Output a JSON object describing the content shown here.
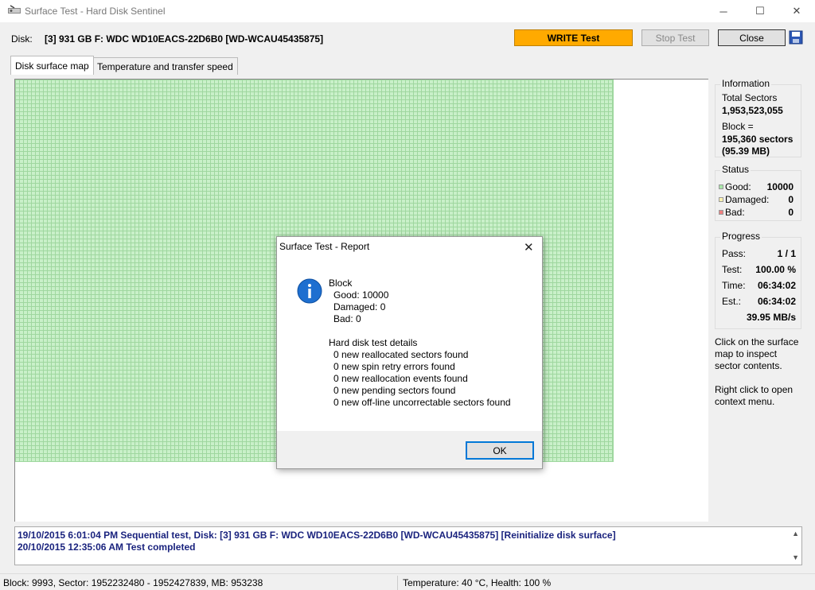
{
  "window": {
    "title": "Surface Test - Hard Disk Sentinel",
    "minimize": "─",
    "maximize": "☐",
    "close": "✕"
  },
  "toolbar": {
    "disk_label": "Disk:",
    "disk_value": "[3] 931 GB F: WDC WD10EACS-22D6B0 [WD-WCAU45435875]",
    "write_test": "WRITE Test",
    "stop_test": "Stop Test",
    "close": "Close"
  },
  "tabs": [
    {
      "label": "Disk surface map"
    },
    {
      "label": "Temperature and transfer speed"
    }
  ],
  "surface_map": {
    "blocks_good": 10000,
    "color_good": "#c9f0c9"
  },
  "information": {
    "title": "Information",
    "total_sectors_label": "Total Sectors",
    "total_sectors_value": "1,953,523,055",
    "block_label": "Block =",
    "block_sectors": "195,360 sectors",
    "block_size": "(95.39 MB)"
  },
  "status": {
    "title": "Status",
    "good_label": "Good:",
    "good_value": "10000",
    "good_color": "#a8e6a8",
    "damaged_label": "Damaged:",
    "damaged_value": "0",
    "damaged_color": "#fff3b0",
    "bad_label": "Bad:",
    "bad_value": "0",
    "bad_color": "#f08080"
  },
  "progress": {
    "title": "Progress",
    "pass_label": "Pass:",
    "pass_value": "1 / 1",
    "test_label": "Test:",
    "test_value": "100.00 %",
    "time_label": "Time:",
    "time_value": "06:34:02",
    "est_label": "Est.:",
    "est_value": "06:34:02",
    "speed": "39.95 MB/s"
  },
  "help": {
    "inspect": [
      "Click on the surface",
      "map to inspect",
      "sector contents."
    ],
    "context": [
      "Right click to open",
      "context menu."
    ]
  },
  "log": [
    "19/10/2015  6:01:04 PM   Sequential test, Disk: [3] 931 GB F: WDC WD10EACS-22D6B0 [WD-WCAU45435875] [Reinitialize disk surface]",
    "20/10/2015  12:35:06 AM   Test completed"
  ],
  "statusbar": {
    "block_info": "Block: 9993, Sector: 1952232480 - 1952427839, MB: 953238",
    "temp_health": "Temperature: 40  °C,  Health: 100 %"
  },
  "dialog": {
    "title": "Surface Test - Report",
    "block_heading": "Block",
    "good": "Good: 10000",
    "damaged": "Damaged: 0",
    "bad": "Bad: 0",
    "details_heading": "Hard disk test details",
    "details": [
      "0 new reallocated sectors found",
      "0 new spin retry errors found",
      "0 new reallocation events found",
      "0 new pending sectors found",
      "0 new off-line uncorrectable sectors found"
    ],
    "ok": "OK"
  }
}
